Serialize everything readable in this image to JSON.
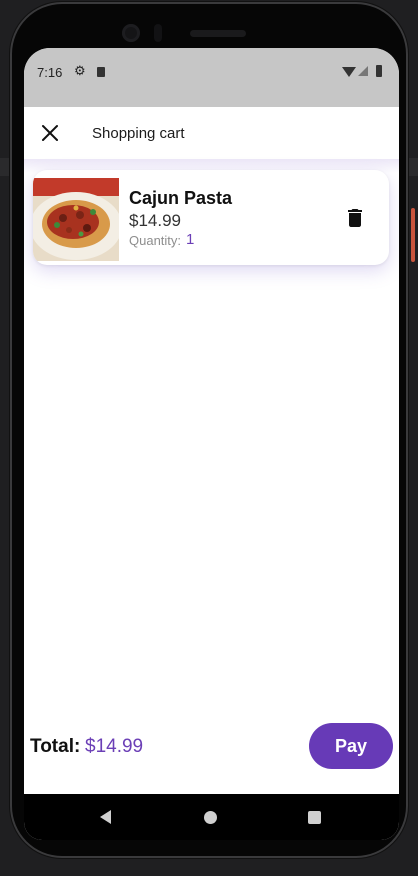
{
  "status_bar": {
    "time": "7:16",
    "settings_icon": "gear-icon",
    "sim_icon": "sim-card-icon",
    "wifi_icon": "wifi-icon",
    "signal_icon": "signal-icon",
    "battery_icon": "battery-icon"
  },
  "toolbar": {
    "close_icon": "close-icon",
    "title": "Shopping cart"
  },
  "cart": {
    "items": [
      {
        "name": "Cajun Pasta",
        "price": "$14.99",
        "quantity_label": "Quantity:",
        "quantity": "1",
        "image_icon": "pasta-photo",
        "delete_icon": "trash-icon"
      }
    ]
  },
  "footer": {
    "total_label": "Total:",
    "total_value": "$14.99",
    "pay_label": "Pay"
  },
  "nav_bar": {
    "back_icon": "back-triangle-icon",
    "home_icon": "home-circle-icon",
    "recents_icon": "recents-square-icon"
  },
  "colors": {
    "accent": "#673ab7",
    "accent_text": "#6b3fb6",
    "status_bar_bg": "#c6c6c6",
    "device_frame": "#060606"
  }
}
